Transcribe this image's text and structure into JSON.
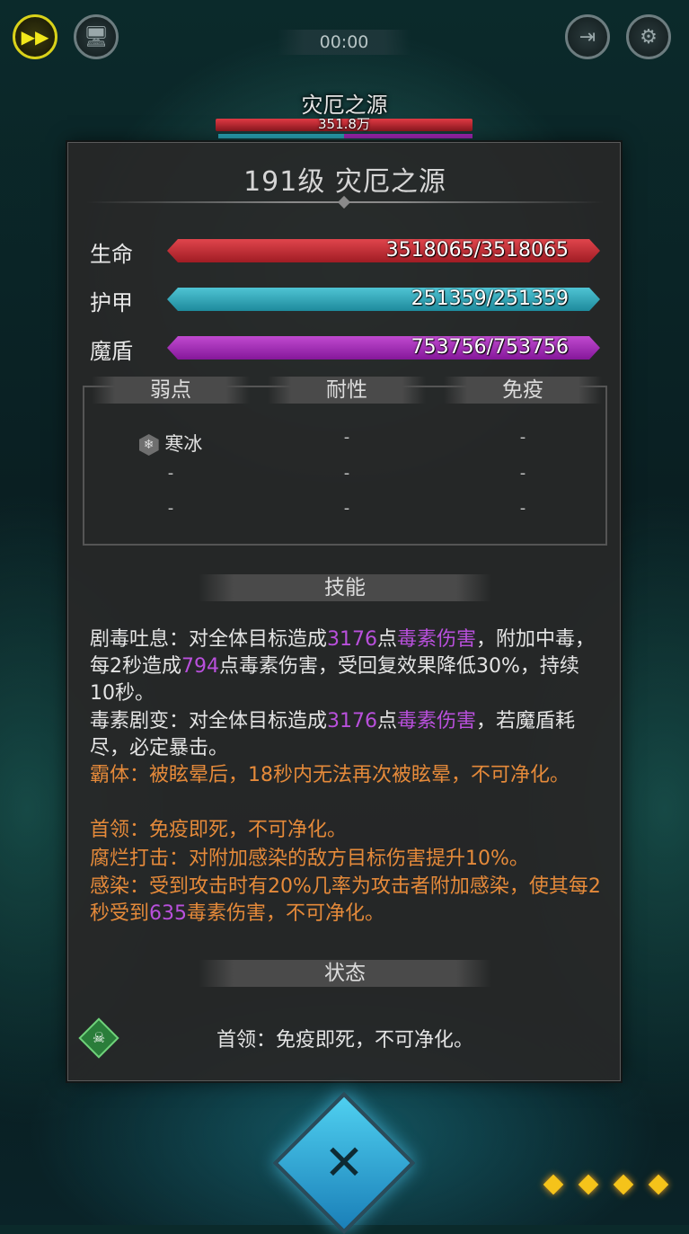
{
  "hud": {
    "timer": "00:00",
    "speed_icon": "fast-forward-icon",
    "auto_icon": "auto-screen-icon",
    "exit_icon": "exit-door-icon",
    "settings_icon": "gear-icon"
  },
  "boss": {
    "name": "灾厄之源",
    "hp_text": "351.8万"
  },
  "panel": {
    "title": "191级  灾厄之源",
    "stats": [
      {
        "label": "生命",
        "value": "3518065/3518065",
        "fill": 1.0,
        "color": "#c42a30"
      },
      {
        "label": "护甲",
        "value": "251359/251359",
        "fill": 1.0,
        "color": "#2aa6b8"
      },
      {
        "label": "魔盾",
        "value": "753756/753756",
        "fill": 1.0,
        "color": "#a126b5"
      }
    ],
    "resist": {
      "headers": [
        "弱点",
        "耐性",
        "免疫"
      ],
      "rows": [
        [
          "寒冰",
          "-",
          "-"
        ],
        [
          "-",
          "-",
          "-"
        ],
        [
          "-",
          "-",
          "-"
        ]
      ]
    },
    "skills_header": "技能",
    "skills": [
      {
        "parts": [
          [
            "剧毒吐息：对全体目标造成",
            "n"
          ],
          [
            "3176",
            "p"
          ],
          [
            "点",
            "n"
          ],
          [
            "毒素伤害",
            "p"
          ],
          [
            "，附加中毒，每2秒造成",
            "n"
          ],
          [
            "794",
            "p"
          ],
          [
            "点毒素伤害，受回复效果降低30%，持续10秒。",
            "n"
          ]
        ],
        "orange": false
      },
      {
        "parts": [
          [
            "毒素剧变：对全体目标造成",
            "n"
          ],
          [
            "3176",
            "p"
          ],
          [
            "点",
            "n"
          ],
          [
            "毒素伤害",
            "p"
          ],
          [
            "，若魔盾耗尽，必定暴击。",
            "n"
          ]
        ],
        "orange": false
      },
      {
        "parts": [
          [
            "霸体：被眩晕后，18秒内无法再次被眩晕，不可净化。",
            "n"
          ]
        ],
        "orange": true
      },
      {
        "parts": [
          [
            "首领：免疫即死，不可净化。",
            "n"
          ]
        ],
        "orange": true
      },
      {
        "parts": [
          [
            "腐烂打击：对附加感染的敌方目标伤害提升10%。",
            "n"
          ]
        ],
        "orange": true
      },
      {
        "parts": [
          [
            "感染：受到攻击时有20%几率为攻击者附加感染，使其每2秒受到",
            "n"
          ],
          [
            "635",
            "p"
          ],
          [
            "毒素伤害，不可净化。",
            "n"
          ]
        ],
        "orange": true
      }
    ],
    "status_header": "状态",
    "status_text": "首领：免疫即死，不可净化。"
  },
  "colors": {
    "purple_text": "#b950dc",
    "orange_text": "#e58a3a",
    "panel_bg": "#282828"
  }
}
